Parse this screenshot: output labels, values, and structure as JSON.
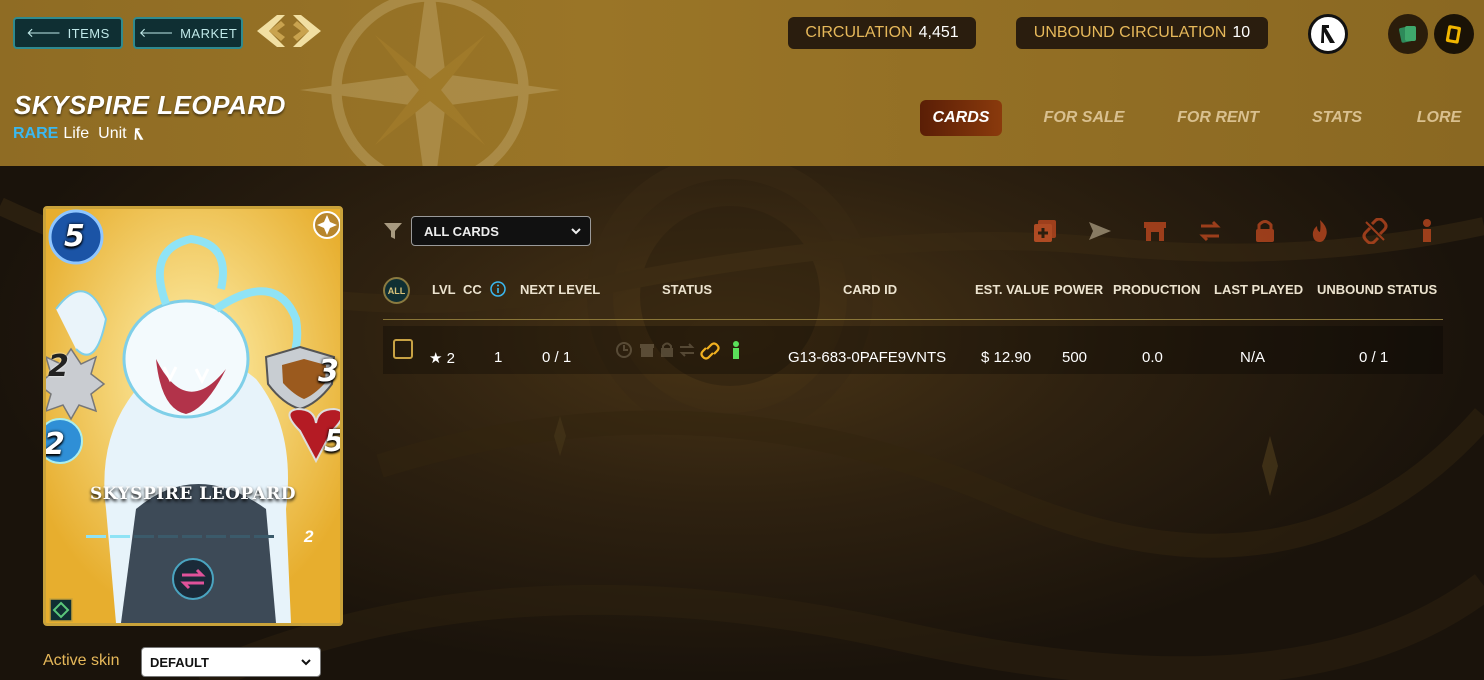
{
  "nav": {
    "items_label": "ITEMS",
    "market_label": "MARKET",
    "arrow_icon": "left-arrow-icon"
  },
  "stats": {
    "circulation_label": "CIRCULATION",
    "circulation_value": "4,451",
    "unbound_label": "UNBOUND CIRCULATION",
    "unbound_value": "10"
  },
  "header": {
    "title": "SKYSPIRE LEOPARD",
    "rarity": "RARE",
    "element": "Life",
    "type": "Unit"
  },
  "tabs": [
    {
      "label": "CARDS",
      "active": true
    },
    {
      "label": "FOR SALE",
      "active": false
    },
    {
      "label": "FOR RENT",
      "active": false
    },
    {
      "label": "STATS",
      "active": false
    },
    {
      "label": "LORE",
      "active": false
    }
  ],
  "card": {
    "name": "SKYSPIRE LEOPARD",
    "mana": "5",
    "attack": "2",
    "speed": "2",
    "armor": "3",
    "health": "5",
    "level": "2"
  },
  "skin": {
    "label": "Active skin",
    "selected": "DEFAULT"
  },
  "filter": {
    "selected": "ALL CARDS"
  },
  "table": {
    "all_badge": "ALL",
    "headers": [
      "LVL",
      "CC",
      "NEXT LEVEL",
      "STATUS",
      "CARD ID",
      "EST. VALUE",
      "POWER",
      "PRODUCTION",
      "LAST PLAYED",
      "UNBOUND STATUS"
    ],
    "rows": [
      {
        "lvl": "★ 2",
        "cc": "1",
        "next_level": "0 / 1",
        "card_id": "G13-683-0PAFE9VNTS",
        "est_value": "$ 12.90",
        "power": "500",
        "production": "0.0",
        "last_played": "N/A",
        "unbound_status": "0 / 1"
      }
    ]
  },
  "colors": {
    "header_gold": "#9a7527",
    "accent_teal": "#2f8a8f",
    "rare_blue": "#3ab8f0",
    "tab_active": "#8a3a0c"
  }
}
